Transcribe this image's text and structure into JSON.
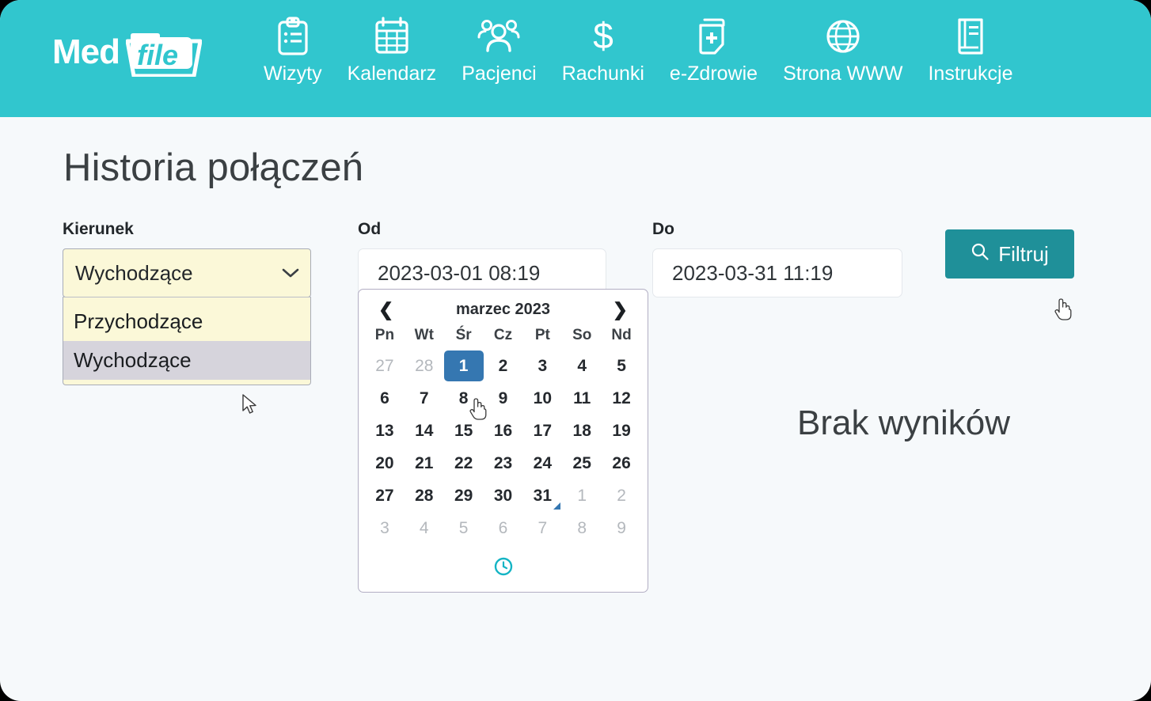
{
  "brand": {
    "med": "Med",
    "file": "file"
  },
  "nav": {
    "items": [
      {
        "label": "Wizyty",
        "icon": "clipboard-icon"
      },
      {
        "label": "Kalendarz",
        "icon": "calendar-icon"
      },
      {
        "label": "Pacjenci",
        "icon": "people-icon"
      },
      {
        "label": "Rachunki",
        "icon": "dollar-icon"
      },
      {
        "label": "e-Zdrowie",
        "icon": "medical-document-icon"
      },
      {
        "label": "Strona WWW",
        "icon": "globe-icon"
      },
      {
        "label": "Instrukcje",
        "icon": "book-icon"
      }
    ]
  },
  "page": {
    "title": "Historia połączeń"
  },
  "filters": {
    "kierunek": {
      "label": "Kierunek",
      "selected": "Wychodzące",
      "options": [
        {
          "label": "Przychodzące",
          "selected": false
        },
        {
          "label": "Wychodzące",
          "selected": true
        }
      ]
    },
    "od": {
      "label": "Od",
      "value": "2023-03-01 08:19"
    },
    "do": {
      "label": "Do",
      "value": "2023-03-31 11:19"
    },
    "filter_button": {
      "label": "Filtruj",
      "icon": "search-icon"
    }
  },
  "calendar": {
    "month_label": "marzec 2023",
    "prev_label": "❮",
    "next_label": "❯",
    "weekdays": [
      "Pn",
      "Wt",
      "Śr",
      "Cz",
      "Pt",
      "So",
      "Nd"
    ],
    "weeks": [
      [
        {
          "d": "27",
          "muted": true
        },
        {
          "d": "28",
          "muted": true
        },
        {
          "d": "1",
          "selected": true
        },
        {
          "d": "2"
        },
        {
          "d": "3"
        },
        {
          "d": "4"
        },
        {
          "d": "5"
        }
      ],
      [
        {
          "d": "6"
        },
        {
          "d": "7"
        },
        {
          "d": "8"
        },
        {
          "d": "9"
        },
        {
          "d": "10"
        },
        {
          "d": "11"
        },
        {
          "d": "12"
        }
      ],
      [
        {
          "d": "13"
        },
        {
          "d": "14"
        },
        {
          "d": "15"
        },
        {
          "d": "16"
        },
        {
          "d": "17"
        },
        {
          "d": "18"
        },
        {
          "d": "19"
        }
      ],
      [
        {
          "d": "20"
        },
        {
          "d": "21"
        },
        {
          "d": "22"
        },
        {
          "d": "23"
        },
        {
          "d": "24"
        },
        {
          "d": "25"
        },
        {
          "d": "26"
        }
      ],
      [
        {
          "d": "27"
        },
        {
          "d": "28"
        },
        {
          "d": "29"
        },
        {
          "d": "30"
        },
        {
          "d": "31",
          "marked": true
        },
        {
          "d": "1",
          "muted": true
        },
        {
          "d": "2",
          "muted": true
        }
      ],
      [
        {
          "d": "3",
          "muted": true
        },
        {
          "d": "4",
          "muted": true
        },
        {
          "d": "5",
          "muted": true
        },
        {
          "d": "6",
          "muted": true
        },
        {
          "d": "7",
          "muted": true
        },
        {
          "d": "8",
          "muted": true
        },
        {
          "d": "9",
          "muted": true
        }
      ]
    ],
    "time_toggle_icon": "clock-icon"
  },
  "results": {
    "empty_message": "Brak wyników"
  },
  "colors": {
    "header_teal": "#31c6ce",
    "button_teal": "#1f9099",
    "page_bg": "#f6f9fb",
    "select_yellow": "#fbf8d8",
    "select_highlight": "#d6d4dc",
    "calendar_selected_blue": "#3577b1",
    "clock_teal": "#14b4c4"
  }
}
